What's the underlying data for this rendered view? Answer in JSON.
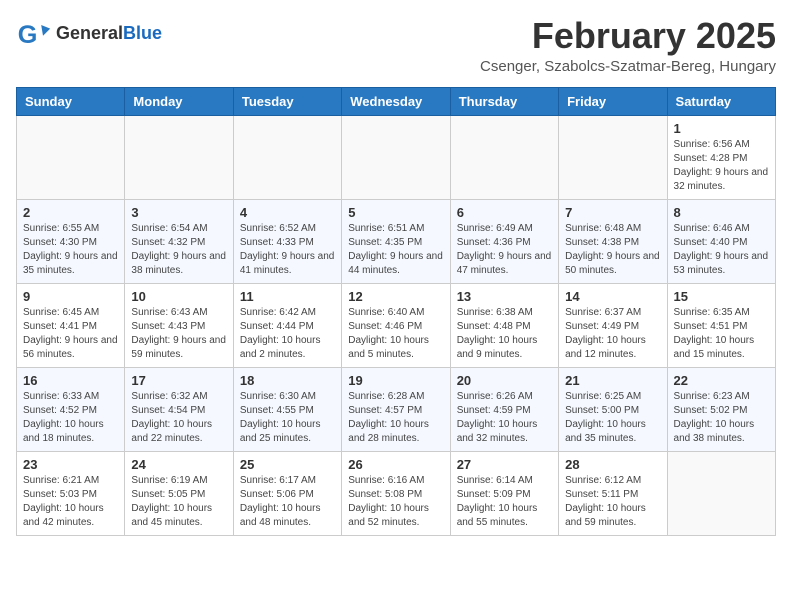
{
  "header": {
    "logo_general": "General",
    "logo_blue": "Blue",
    "month_title": "February 2025",
    "location": "Csenger, Szabolcs-Szatmar-Bereg, Hungary"
  },
  "weekdays": [
    "Sunday",
    "Monday",
    "Tuesday",
    "Wednesday",
    "Thursday",
    "Friday",
    "Saturday"
  ],
  "weeks": [
    [
      {
        "day": "",
        "info": ""
      },
      {
        "day": "",
        "info": ""
      },
      {
        "day": "",
        "info": ""
      },
      {
        "day": "",
        "info": ""
      },
      {
        "day": "",
        "info": ""
      },
      {
        "day": "",
        "info": ""
      },
      {
        "day": "1",
        "info": "Sunrise: 6:56 AM\nSunset: 4:28 PM\nDaylight: 9 hours and 32 minutes."
      }
    ],
    [
      {
        "day": "2",
        "info": "Sunrise: 6:55 AM\nSunset: 4:30 PM\nDaylight: 9 hours and 35 minutes."
      },
      {
        "day": "3",
        "info": "Sunrise: 6:54 AM\nSunset: 4:32 PM\nDaylight: 9 hours and 38 minutes."
      },
      {
        "day": "4",
        "info": "Sunrise: 6:52 AM\nSunset: 4:33 PM\nDaylight: 9 hours and 41 minutes."
      },
      {
        "day": "5",
        "info": "Sunrise: 6:51 AM\nSunset: 4:35 PM\nDaylight: 9 hours and 44 minutes."
      },
      {
        "day": "6",
        "info": "Sunrise: 6:49 AM\nSunset: 4:36 PM\nDaylight: 9 hours and 47 minutes."
      },
      {
        "day": "7",
        "info": "Sunrise: 6:48 AM\nSunset: 4:38 PM\nDaylight: 9 hours and 50 minutes."
      },
      {
        "day": "8",
        "info": "Sunrise: 6:46 AM\nSunset: 4:40 PM\nDaylight: 9 hours and 53 minutes."
      }
    ],
    [
      {
        "day": "9",
        "info": "Sunrise: 6:45 AM\nSunset: 4:41 PM\nDaylight: 9 hours and 56 minutes."
      },
      {
        "day": "10",
        "info": "Sunrise: 6:43 AM\nSunset: 4:43 PM\nDaylight: 9 hours and 59 minutes."
      },
      {
        "day": "11",
        "info": "Sunrise: 6:42 AM\nSunset: 4:44 PM\nDaylight: 10 hours and 2 minutes."
      },
      {
        "day": "12",
        "info": "Sunrise: 6:40 AM\nSunset: 4:46 PM\nDaylight: 10 hours and 5 minutes."
      },
      {
        "day": "13",
        "info": "Sunrise: 6:38 AM\nSunset: 4:48 PM\nDaylight: 10 hours and 9 minutes."
      },
      {
        "day": "14",
        "info": "Sunrise: 6:37 AM\nSunset: 4:49 PM\nDaylight: 10 hours and 12 minutes."
      },
      {
        "day": "15",
        "info": "Sunrise: 6:35 AM\nSunset: 4:51 PM\nDaylight: 10 hours and 15 minutes."
      }
    ],
    [
      {
        "day": "16",
        "info": "Sunrise: 6:33 AM\nSunset: 4:52 PM\nDaylight: 10 hours and 18 minutes."
      },
      {
        "day": "17",
        "info": "Sunrise: 6:32 AM\nSunset: 4:54 PM\nDaylight: 10 hours and 22 minutes."
      },
      {
        "day": "18",
        "info": "Sunrise: 6:30 AM\nSunset: 4:55 PM\nDaylight: 10 hours and 25 minutes."
      },
      {
        "day": "19",
        "info": "Sunrise: 6:28 AM\nSunset: 4:57 PM\nDaylight: 10 hours and 28 minutes."
      },
      {
        "day": "20",
        "info": "Sunrise: 6:26 AM\nSunset: 4:59 PM\nDaylight: 10 hours and 32 minutes."
      },
      {
        "day": "21",
        "info": "Sunrise: 6:25 AM\nSunset: 5:00 PM\nDaylight: 10 hours and 35 minutes."
      },
      {
        "day": "22",
        "info": "Sunrise: 6:23 AM\nSunset: 5:02 PM\nDaylight: 10 hours and 38 minutes."
      }
    ],
    [
      {
        "day": "23",
        "info": "Sunrise: 6:21 AM\nSunset: 5:03 PM\nDaylight: 10 hours and 42 minutes."
      },
      {
        "day": "24",
        "info": "Sunrise: 6:19 AM\nSunset: 5:05 PM\nDaylight: 10 hours and 45 minutes."
      },
      {
        "day": "25",
        "info": "Sunrise: 6:17 AM\nSunset: 5:06 PM\nDaylight: 10 hours and 48 minutes."
      },
      {
        "day": "26",
        "info": "Sunrise: 6:16 AM\nSunset: 5:08 PM\nDaylight: 10 hours and 52 minutes."
      },
      {
        "day": "27",
        "info": "Sunrise: 6:14 AM\nSunset: 5:09 PM\nDaylight: 10 hours and 55 minutes."
      },
      {
        "day": "28",
        "info": "Sunrise: 6:12 AM\nSunset: 5:11 PM\nDaylight: 10 hours and 59 minutes."
      },
      {
        "day": "",
        "info": ""
      }
    ]
  ]
}
